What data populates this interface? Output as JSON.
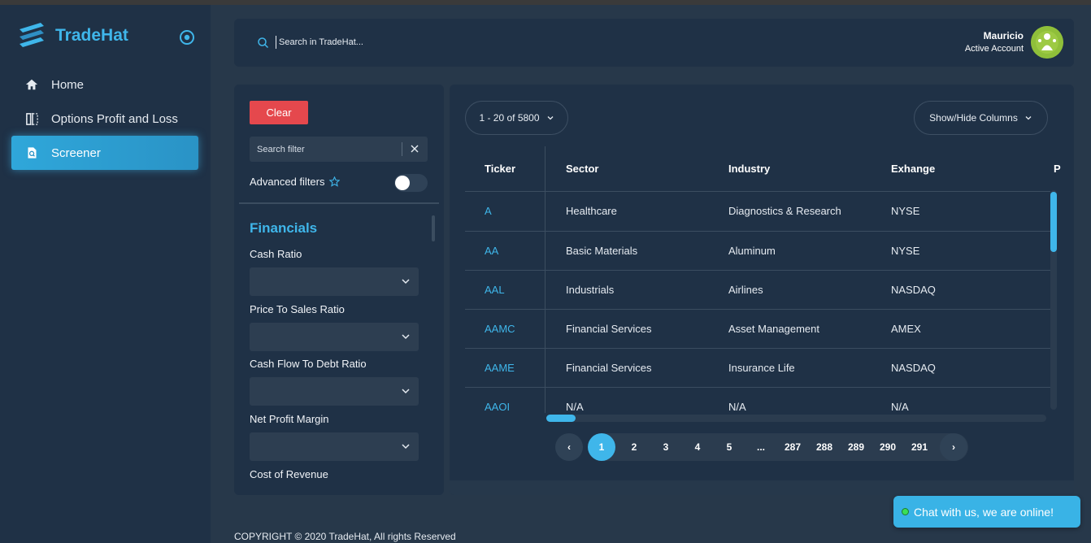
{
  "app": {
    "name": "TradeHat"
  },
  "sidebar": {
    "items": [
      {
        "label": "Home",
        "icon": "home-icon",
        "active": false
      },
      {
        "label": "Options Profit and Loss",
        "icon": "split-panel-icon",
        "active": false
      },
      {
        "label": "Screener",
        "icon": "screener-icon",
        "active": true
      }
    ]
  },
  "header": {
    "search_placeholder": "Search in TradeHat...",
    "user_name": "Mauricio",
    "user_status": "Active Account"
  },
  "filters": {
    "clear_label": "Clear",
    "search_placeholder": "Search filter",
    "advanced_label": "Advanced filters",
    "advanced_enabled": false,
    "section_title": "Financials",
    "fields": [
      {
        "label": "Cash Ratio",
        "value": ""
      },
      {
        "label": "Price To Sales Ratio",
        "value": ""
      },
      {
        "label": "Cash Flow To Debt Ratio",
        "value": ""
      },
      {
        "label": "Net Profit Margin",
        "value": ""
      },
      {
        "label": "Cost of Revenue",
        "value": ""
      }
    ]
  },
  "table": {
    "range_label": "1 - 20 of 5800",
    "columns_button": "Show/Hide Columns",
    "headers": [
      "Ticker",
      "Sector",
      "Industry",
      "Exhange",
      "P"
    ],
    "rows": [
      {
        "ticker": "A",
        "sector": "Healthcare",
        "industry": "Diagnostics & Research",
        "exchange": "NYSE"
      },
      {
        "ticker": "AA",
        "sector": "Basic Materials",
        "industry": "Aluminum",
        "exchange": "NYSE"
      },
      {
        "ticker": "AAL",
        "sector": "Industrials",
        "industry": "Airlines",
        "exchange": "NASDAQ"
      },
      {
        "ticker": "AAMC",
        "sector": "Financial Services",
        "industry": "Asset Management",
        "exchange": "AMEX"
      },
      {
        "ticker": "AAME",
        "sector": "Financial Services",
        "industry": "Insurance Life",
        "exchange": "NASDAQ"
      },
      {
        "ticker": "AAOI",
        "sector": "N/A",
        "industry": "N/A",
        "exchange": "N/A"
      }
    ],
    "pagination": {
      "prev": "‹",
      "next": "›",
      "pages": [
        "1",
        "2",
        "3",
        "4",
        "5",
        "...",
        "287",
        "288",
        "289",
        "290",
        "291"
      ],
      "current": "1"
    }
  },
  "footer": {
    "copyright": "COPYRIGHT © 2020 TradeHat, All rights Reserved"
  },
  "chat": {
    "label": "Chat with us, we are online!"
  },
  "colors": {
    "accent": "#3fb6ea",
    "panel": "#1f3146",
    "background": "#27384a",
    "danger": "#e5484d",
    "online": "#3adf56"
  }
}
